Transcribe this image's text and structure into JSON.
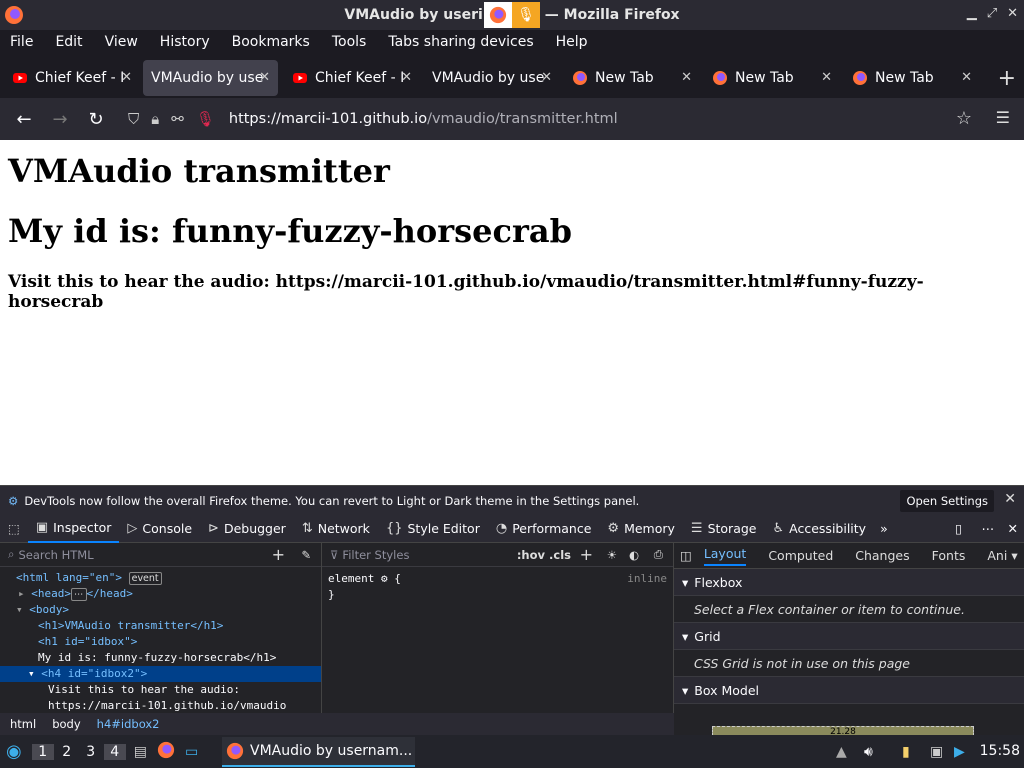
{
  "window": {
    "title": "VMAudio by username — Mozilla Firefox",
    "title_left": "VMAudio by useri",
    "title_right": "— Mozilla Firefox"
  },
  "menu": [
    "File",
    "Edit",
    "View",
    "History",
    "Bookmarks",
    "Tools",
    "Tabs sharing devices",
    "Help"
  ],
  "tabs": [
    {
      "label": "Chief Keef - I",
      "icon": "youtube-icon",
      "active": false
    },
    {
      "label": "VMAudio by use",
      "icon": "none",
      "active": true
    },
    {
      "label": "Chief Keef - I",
      "icon": "youtube-icon",
      "active": false
    },
    {
      "label": "VMAudio by use",
      "icon": "none",
      "active": false
    },
    {
      "label": "New Tab",
      "icon": "firefox-icon",
      "active": false
    },
    {
      "label": "New Tab",
      "icon": "firefox-icon",
      "active": false
    },
    {
      "label": "New Tab",
      "icon": "firefox-icon",
      "active": false
    }
  ],
  "url": {
    "host": "https://marcii-101.github.io",
    "path": "/vmaudio/transmitter.html"
  },
  "page": {
    "h1": "VMAudio transmitter",
    "h1b": "My id is: funny-fuzzy-horsecrab",
    "h4": "Visit this to hear the audio: https://marcii-101.github.io/vmaudio/transmitter.html#funny-fuzzy-horsecrab"
  },
  "devtools": {
    "notice": "DevTools now follow the overall Firefox theme. You can revert to Light or Dark theme in the Settings panel.",
    "open_settings": "Open Settings",
    "tabs": [
      "Inspector",
      "Console",
      "Debugger",
      "Network",
      "Style Editor",
      "Performance",
      "Memory",
      "Storage",
      "Accessibility"
    ],
    "search_placeholder": "Search HTML",
    "filter_placeholder": "Filter Styles",
    "hov_cls": ":hov .cls",
    "rule_selector": "element",
    "rule_open": "{",
    "rule_close": "}",
    "rule_source": "inline",
    "right_tabs": [
      "Layout",
      "Computed",
      "Changes",
      "Fonts",
      "Ani"
    ],
    "flexbox": "Flexbox",
    "flexbox_msg": "Select a Flex container or item to continue.",
    "grid": "Grid",
    "grid_msg": "CSS Grid is not in use on this page",
    "boxmodel": "Box Model",
    "boxmodel_value": "21.28",
    "tree": {
      "html_open": "<html lang=\"en\">",
      "event": "event",
      "head": "<head>",
      "head_close": "</head>",
      "body": "<body>",
      "h1_line": "<h1>VMAudio transmitter</h1>",
      "h1_id": "<h1 id=\"idbox\">",
      "h1_text": "My id is: funny-fuzzy-horsecrab</h1>",
      "h4_line": "<h4 id=\"idbox2\">",
      "h4_text1": "Visit this to hear the audio:",
      "h4_text2": "https://marcii-101.github.io/vmaudio"
    },
    "breadcrumbs": [
      "html",
      "body",
      "h4#idbox2"
    ]
  },
  "taskbar": {
    "workspaces": [
      "1",
      "2",
      "3",
      "4"
    ],
    "active_workspace": "4",
    "app_label": "VMAudio by usernam...",
    "clock": "15:58"
  }
}
